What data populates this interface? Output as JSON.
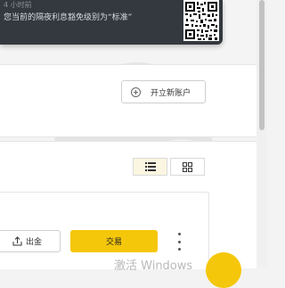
{
  "notification": {
    "time": "4 小时前",
    "message": "您当前的隔夜利息豁免级别为“标准”"
  },
  "account_card": {
    "open_account_label": "开立新账户"
  },
  "wallet_card": {
    "view_toggle": {
      "list_icon": "list-icon",
      "grid_icon": "grid-icon",
      "active": "list"
    },
    "withdraw_label": "出金",
    "trade_label": "交易",
    "more_icon": "more-vertical-icon"
  },
  "os_watermark": "激活 Windows",
  "colors": {
    "accent": "#f5c70a",
    "toast_bg": "#34393f",
    "active_toggle_bg": "#fbf6e1"
  }
}
